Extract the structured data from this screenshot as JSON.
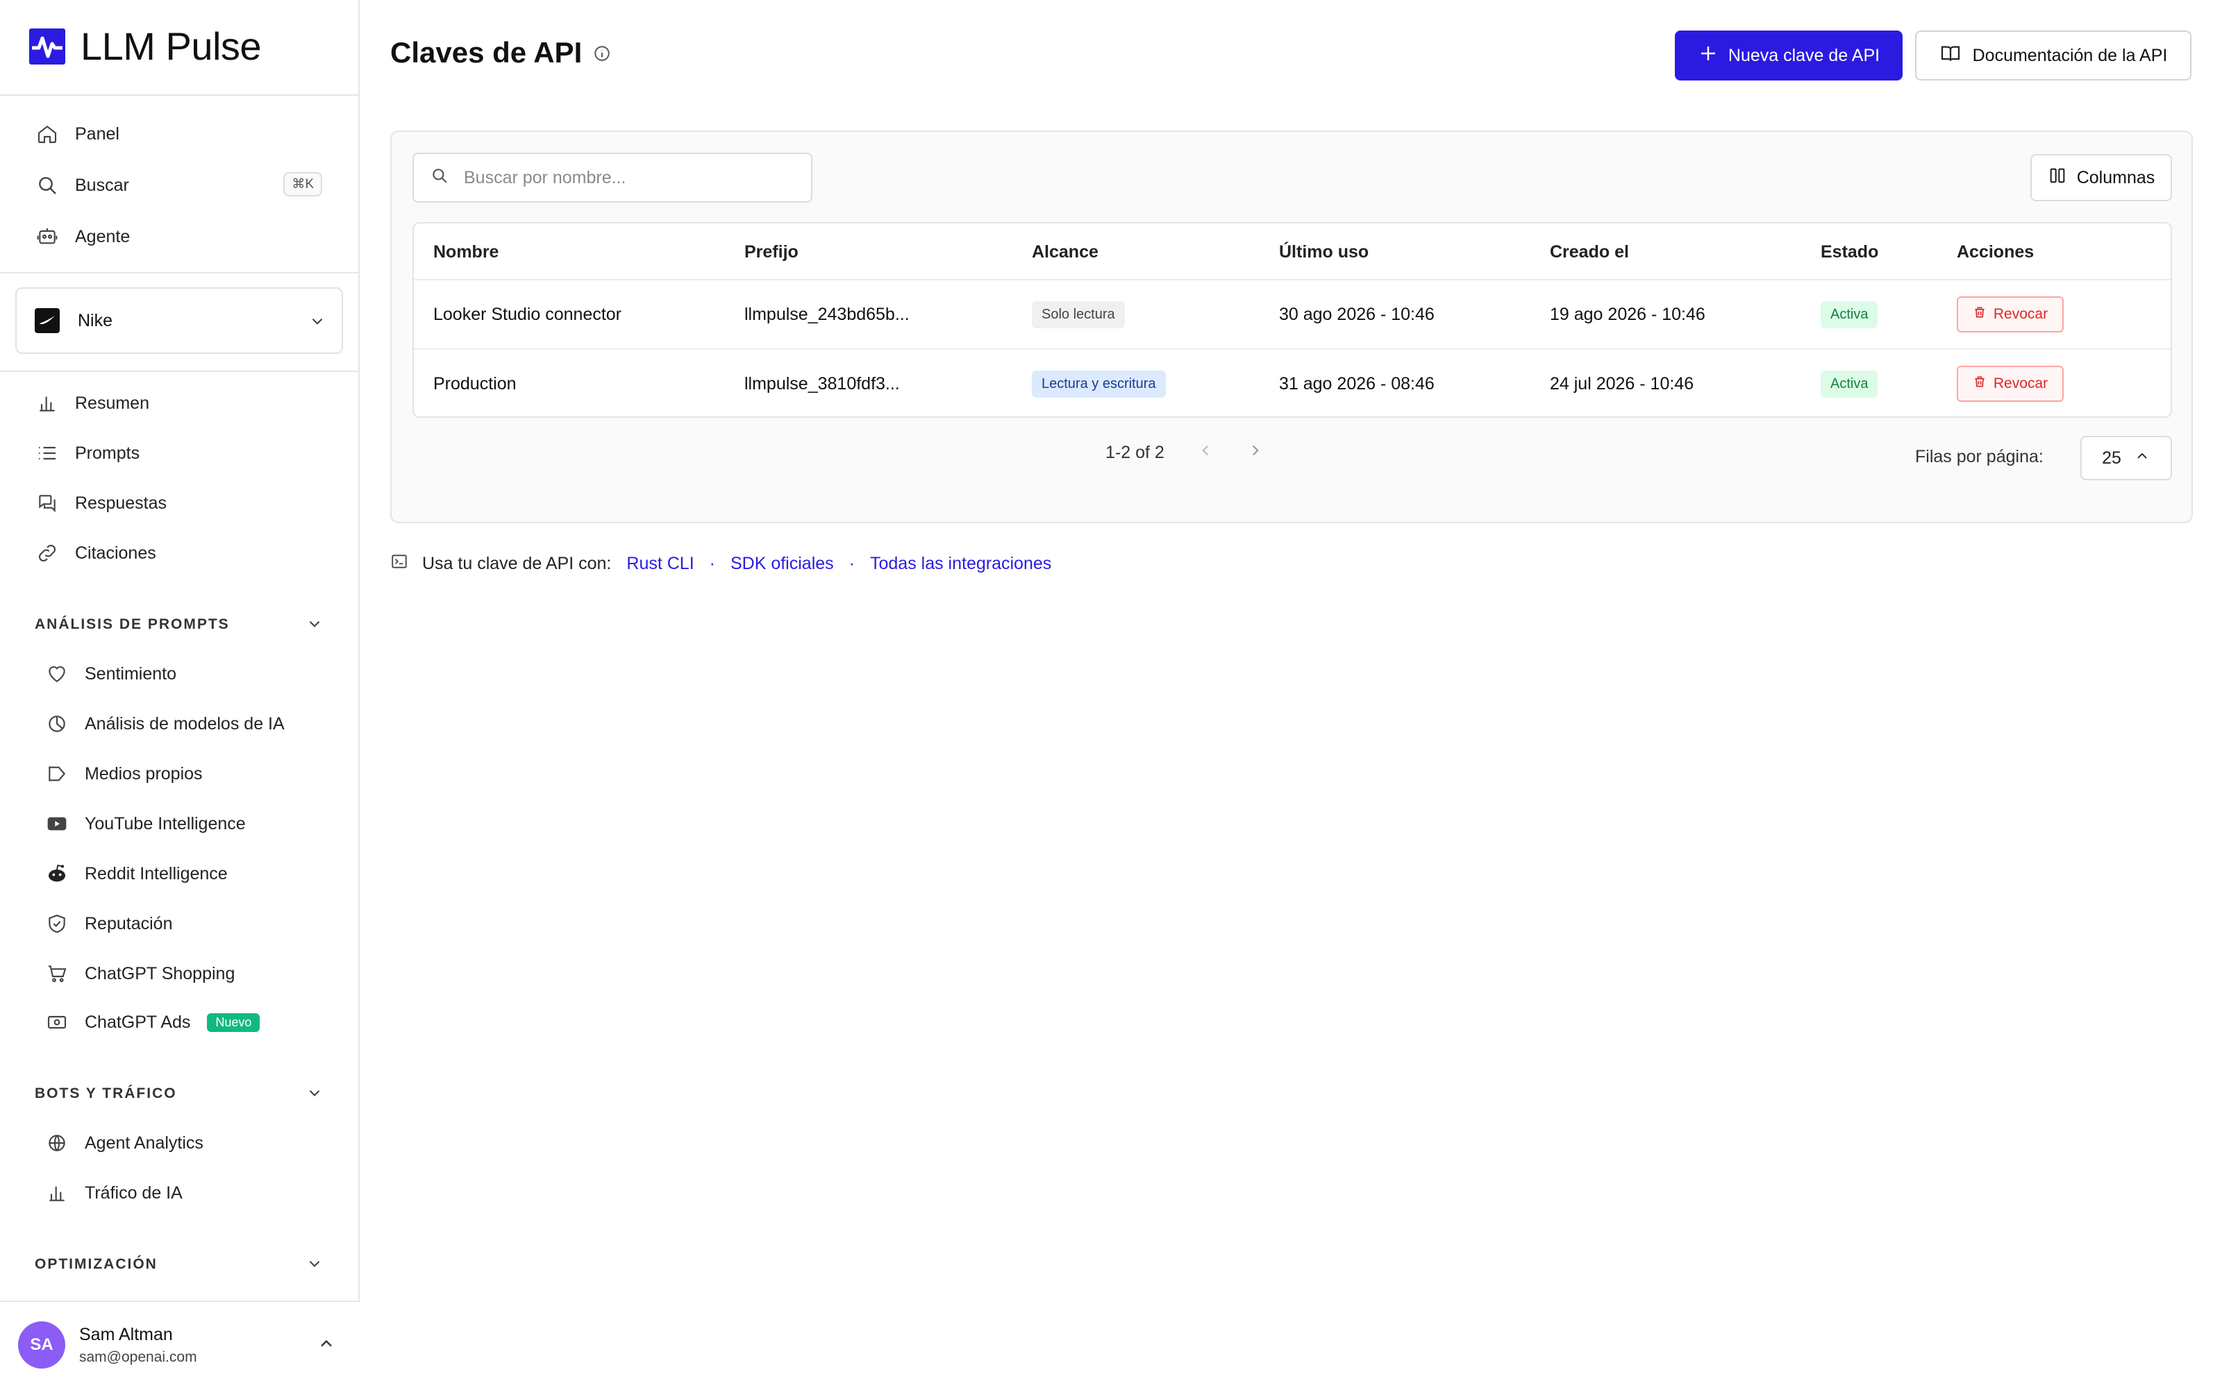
{
  "app": {
    "name": "LLM Pulse"
  },
  "nav": {
    "top": [
      {
        "label": "Panel",
        "icon": "home-icon"
      },
      {
        "label": "Buscar",
        "icon": "search-icon",
        "shortcut": "⌘K"
      },
      {
        "label": "Agente",
        "icon": "robot-icon"
      }
    ],
    "brand": {
      "name": "Nike"
    },
    "main": [
      {
        "label": "Resumen",
        "icon": "bar-chart-icon"
      },
      {
        "label": "Prompts",
        "icon": "list-icon"
      },
      {
        "label": "Respuestas",
        "icon": "chat-icon"
      },
      {
        "label": "Citaciones",
        "icon": "link-icon"
      }
    ],
    "sections": [
      {
        "title": "ANÁLISIS DE PROMPTS",
        "items": [
          {
            "label": "Sentimiento",
            "icon": "heart-icon"
          },
          {
            "label": "Análisis de modelos de IA",
            "icon": "pie-chart-icon"
          },
          {
            "label": "Medios propios",
            "icon": "megaphone-icon"
          },
          {
            "label": "YouTube Intelligence",
            "icon": "youtube-icon"
          },
          {
            "label": "Reddit Intelligence",
            "icon": "reddit-icon"
          },
          {
            "label": "Reputación",
            "icon": "shield-icon"
          },
          {
            "label": "ChatGPT Shopping",
            "icon": "cart-icon"
          },
          {
            "label": "ChatGPT Ads",
            "icon": "ads-icon",
            "badge": "Nuevo"
          }
        ]
      },
      {
        "title": "BOTS Y TRÁFICO",
        "items": [
          {
            "label": "Agent Analytics",
            "icon": "globe-icon"
          },
          {
            "label": "Tráfico de IA",
            "icon": "bar-chart-icon"
          }
        ]
      },
      {
        "title": "OPTIMIZACIÓN",
        "items": []
      }
    ]
  },
  "user": {
    "initials": "SA",
    "name": "Sam Altman",
    "email": "sam@openai.com"
  },
  "page": {
    "title": "Claves de API",
    "new_key_label": "Nueva clave de API",
    "docs_label": "Documentación de la API"
  },
  "search": {
    "placeholder": "Buscar por nombre..."
  },
  "columns_label": "Columnas",
  "table": {
    "headers": [
      "Nombre",
      "Prefijo",
      "Alcance",
      "Último uso",
      "Creado el",
      "Estado",
      "Acciones"
    ],
    "rows": [
      {
        "name": "Looker Studio connector",
        "prefix": "llmpulse_243bd65b...",
        "scope": "Solo lectura",
        "last_used": "30 ago 2026 - 10:46",
        "created": "19 ago 2026 - 10:46",
        "status": "Activa",
        "action": "Revocar"
      },
      {
        "name": "Production",
        "prefix": "llmpulse_3810fdf3...",
        "scope": "Lectura y escritura",
        "last_used": "31 ago 2026 - 08:46",
        "created": "24 jul 2026 - 10:46",
        "status": "Activa",
        "action": "Revocar"
      }
    ]
  },
  "pagination": {
    "range": "1-2 of 2",
    "rows_label": "Filas por página:",
    "rows_value": "25"
  },
  "footer": {
    "prefix": "Usa tu clave de API con:",
    "links": [
      "Rust CLI",
      "SDK oficiales",
      "Todas las integraciones"
    ]
  },
  "colors": {
    "accent": "#2b1be0",
    "success": "#15803d",
    "danger": "#dc2626",
    "avatar": "#8b5cf6"
  }
}
